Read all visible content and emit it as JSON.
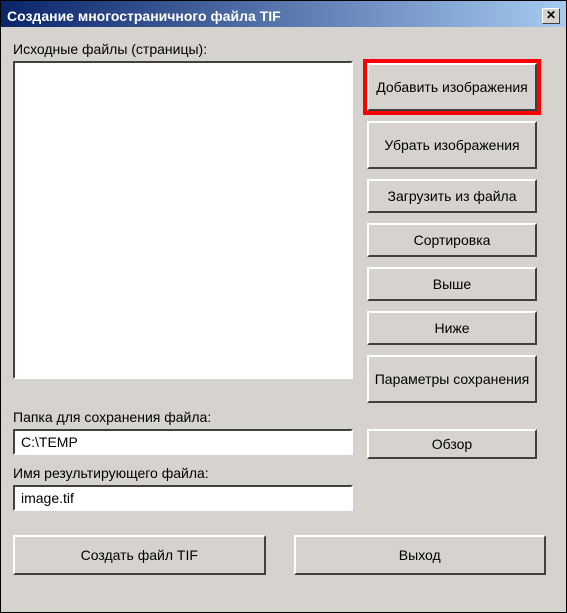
{
  "window": {
    "title": "Создание многостраничного файла TIF",
    "close_glyph": "✕"
  },
  "labels": {
    "source_files": "Исходные файлы (страницы):",
    "save_folder": "Папка для сохранения файла:",
    "result_file": "Имя результирующего файла:"
  },
  "fields": {
    "save_folder": "C:\\TEMP",
    "result_file": "image.tif"
  },
  "buttons": {
    "add_images": "Добавить изображения",
    "remove_images": "Убрать изображения",
    "load_from_file": "Загрузить из файла",
    "sort": "Сортировка",
    "up": "Выше",
    "down": "Ниже",
    "save_params": "Параметры сохранения",
    "browse": "Обзор",
    "create_tif": "Создать файл TIF",
    "exit": "Выход"
  },
  "listbox": {
    "items": []
  }
}
